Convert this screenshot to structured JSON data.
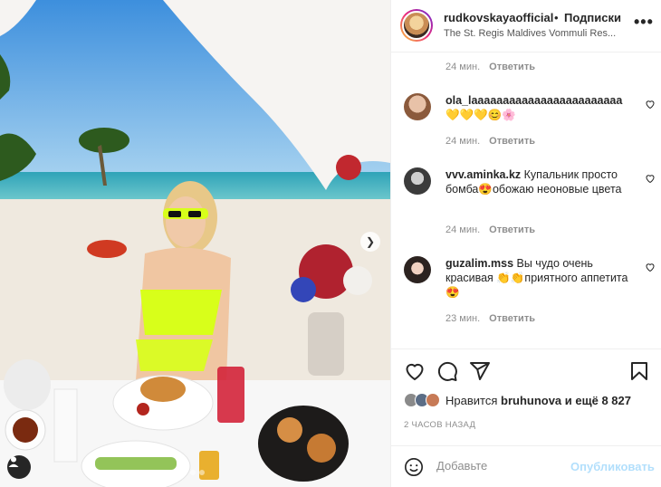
{
  "post": {
    "photo_alt_dots": 3,
    "author": "rudkovskayaofficial",
    "bullet": "•",
    "follow_label": "Подписки",
    "location": "The St. Regis Maldives Vommuli Res...",
    "more_label": "•••"
  },
  "top_meta": {
    "time": "24 мин.",
    "reply": "Ответить"
  },
  "comments": [
    {
      "user": "ola_laaaaaaaaaaaaaaaaaaaaaaaa",
      "text": "💛💛💛😊🌸",
      "time": "24 мин.",
      "reply": "Ответить",
      "avatar_color": "#d9b09a"
    },
    {
      "user": "vvv.aminka.kz",
      "text": "Купальник просто бомба😍обожаю неоновые цвета",
      "time": "24 мин.",
      "reply": "Ответить",
      "avatar_color": "#3b3b3b"
    },
    {
      "user": "guzalim.mss",
      "text": "Вы чудо очень красивая 👏👏приятного аппетита 😍",
      "time": "23 мин.",
      "reply": "Ответить",
      "avatar_color": "#2c2320"
    }
  ],
  "likes": {
    "prefix": "Нравится",
    "user": "bruhunova",
    "suffix": "и ещё 8 827"
  },
  "time_ago": "2 ЧАСОВ НАЗАД",
  "add_comment": {
    "placeholder": "Добавьте",
    "publish_label": "Опубликовать"
  },
  "icons": [
    "heart-icon",
    "comment-icon",
    "share-icon",
    "bookmark-icon",
    "emoji-icon",
    "more-icon",
    "tag-user-icon",
    "chevron-right-icon"
  ],
  "colors": {
    "accent_disabled": "#b2dffc",
    "neon_swimsuit": "#d8ff1a",
    "muted": "#8e8e8e"
  }
}
